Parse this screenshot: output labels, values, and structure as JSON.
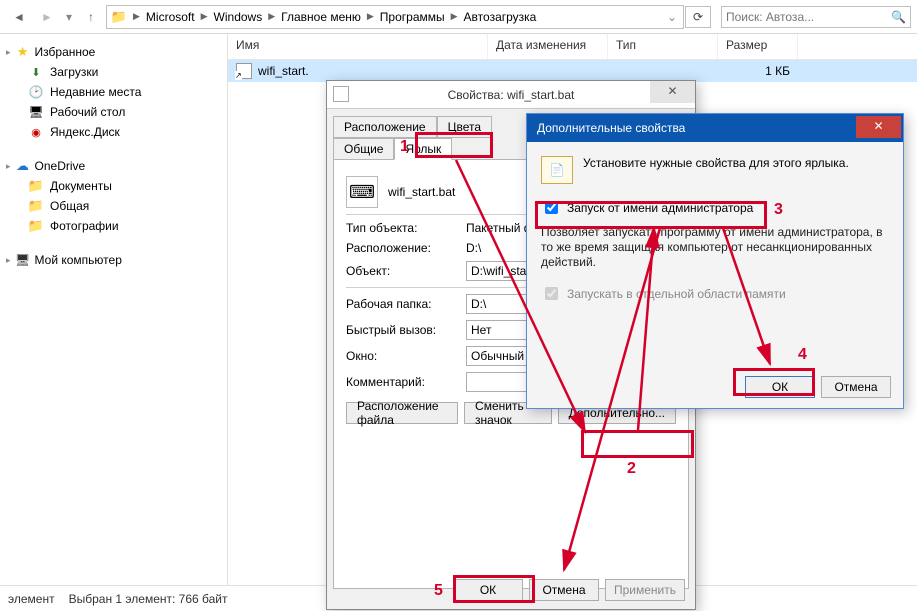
{
  "breadcrumb": {
    "items": [
      "Microsoft",
      "Windows",
      "Главное меню",
      "Программы",
      "Автозагрузка"
    ]
  },
  "search": {
    "placeholder": "Поиск: Автоза..."
  },
  "nav": {
    "fav_header": "Избранное",
    "fav": [
      "Загрузки",
      "Недавние места",
      "Рабочий стол",
      "Яндекс.Диск"
    ],
    "onedrive": "OneDrive",
    "od_items": [
      "Документы",
      "Общая",
      "Фотографии"
    ],
    "pc": "Мой компьютер"
  },
  "columns": {
    "name": "Имя",
    "date": "Дата изменения",
    "type": "Тип",
    "size": "Размер"
  },
  "file": {
    "name": "wifi_start.",
    "size": "1 КБ"
  },
  "status": {
    "count": "элемент",
    "sel": "Выбран 1 элемент: 766 байт"
  },
  "props": {
    "title": "Свойства: wifi_start.bat",
    "tabs": {
      "location": "Расположение",
      "colors": "Цвета",
      "general": "Общие",
      "shortcut": "Ярлык"
    },
    "filename": "wifi_start.bat",
    "lbl_type": "Тип объекта:",
    "val_type": "Пакетный файл",
    "lbl_loc": "Расположение:",
    "val_loc": "D:\\",
    "lbl_obj": "Объект:",
    "val_obj": "D:\\wifi_start.bat",
    "lbl_work": "Рабочая папка:",
    "val_work": "D:\\",
    "lbl_hot": "Быстрый вызов:",
    "val_hot": "Нет",
    "lbl_win": "Окно:",
    "val_win": "Обычный разм",
    "lbl_comm": "Комментарий:",
    "val_comm": "",
    "btn_fileloc": "Расположение файла",
    "btn_icon": "Сменить значок",
    "btn_adv": "Дополнительно...",
    "ok": "ОК",
    "cancel": "Отмена",
    "apply": "Применить"
  },
  "adv": {
    "title": "Дополнительные свойства",
    "info": "Установите нужные свойства для этого ярлыка.",
    "chk_admin": "Запуск от имени администратора",
    "expl": "Позволяет запускать программу от имени администратора, в то же время защищая компьютер от несанкционированных действий.",
    "chk_mem": "Запускать в отдельной области памяти",
    "ok": "ОК",
    "cancel": "Отмена"
  },
  "ann": {
    "n1": "1",
    "n2": "2",
    "n3": "3",
    "n4": "4",
    "n5": "5"
  }
}
